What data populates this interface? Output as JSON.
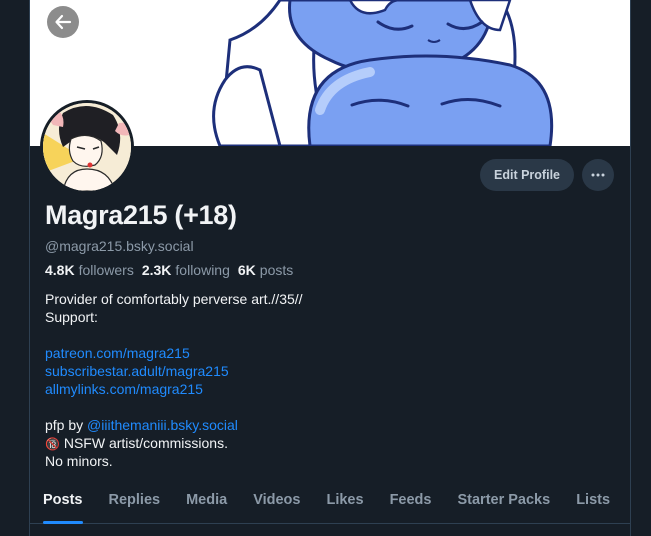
{
  "profile": {
    "display_name": "Magra215 (+18)",
    "handle": "@magra215.bsky.social",
    "followers_count": "4.8K",
    "followers_label": "followers",
    "following_count": "2.3K",
    "following_label": "following",
    "posts_count": "6K",
    "posts_label": "posts"
  },
  "actions": {
    "edit_label": "Edit Profile",
    "more_icon": "ellipsis-icon",
    "back_icon": "arrow-left-icon"
  },
  "bio": {
    "line1": "Provider of comfortably perverse art.//35//",
    "line2": "Support:",
    "link1": "patreon.com/magra215",
    "link2": "subscribestar.adult/magra215",
    "link3": "allmylinks.com/magra215",
    "pfp_prefix": "pfp by ",
    "pfp_mention": "@iiithemaniii.bsky.social",
    "nsfw_emoji": "🔞",
    "nsfw_text": " NSFW artist/commissions.",
    "no_minors": "No minors."
  },
  "tabs": [
    {
      "label": "Posts",
      "active": true
    },
    {
      "label": "Replies"
    },
    {
      "label": "Media"
    },
    {
      "label": "Videos"
    },
    {
      "label": "Likes"
    },
    {
      "label": "Feeds"
    },
    {
      "label": "Starter Packs"
    },
    {
      "label": "Lists"
    }
  ],
  "colors": {
    "background": "#161e27",
    "accent": "#208bfe",
    "muted": "#8c9aa8",
    "button": "#2a3847"
  }
}
